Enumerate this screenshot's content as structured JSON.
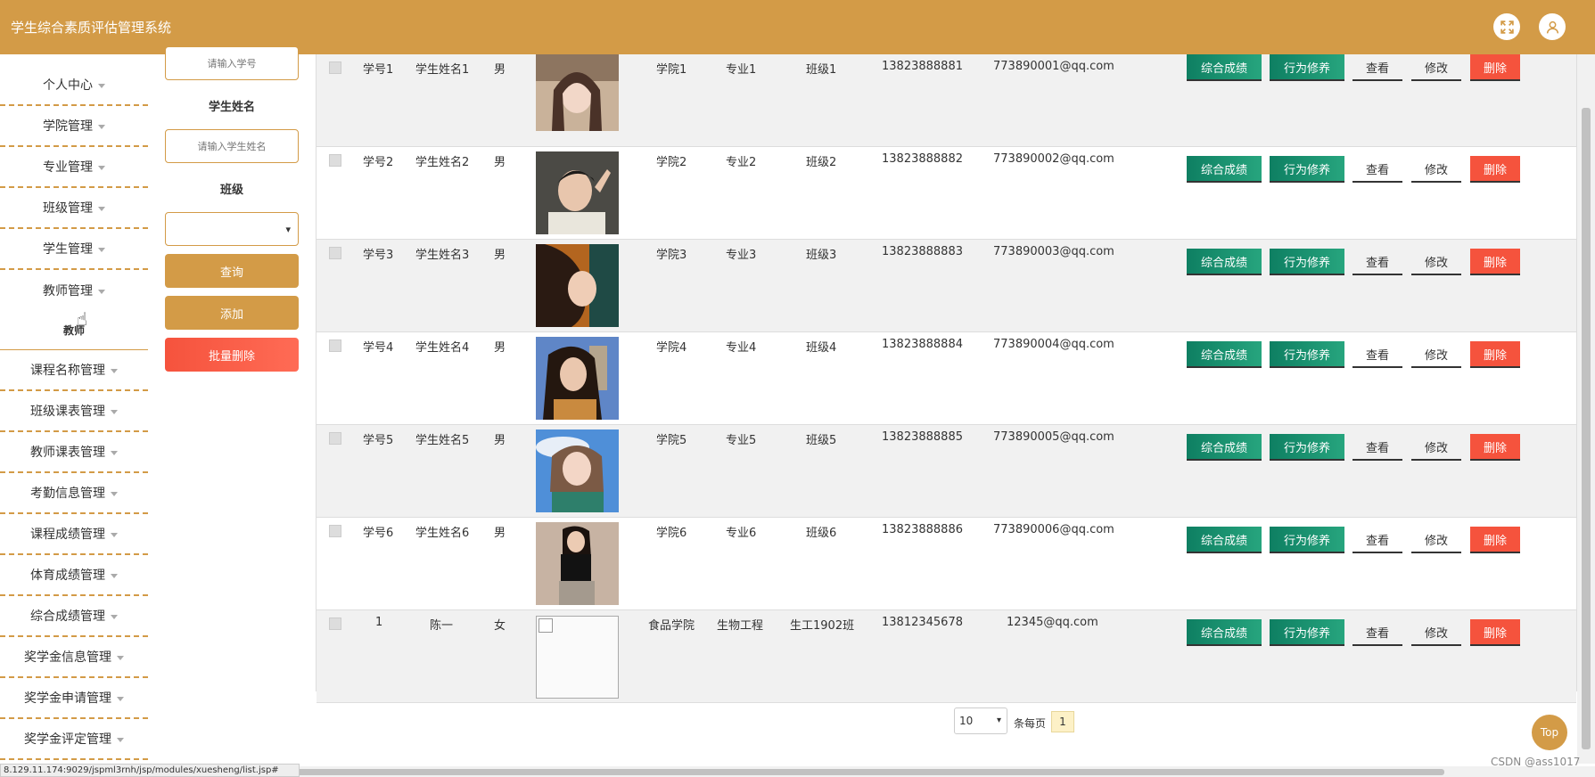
{
  "header": {
    "title": "学生综合素质评估管理系统",
    "fullscreen_icon": "expand-icon",
    "user_icon": "user-icon",
    "accent": "#d39b47"
  },
  "sidebar": {
    "items": [
      {
        "label": "个人中心"
      },
      {
        "label": "学院管理"
      },
      {
        "label": "专业管理"
      },
      {
        "label": "班级管理"
      },
      {
        "label": "学生管理"
      },
      {
        "label": "教师管理"
      }
    ],
    "sub": "教师",
    "items2": [
      {
        "label": "课程名称管理"
      },
      {
        "label": "班级课表管理"
      },
      {
        "label": "教师课表管理"
      },
      {
        "label": "考勤信息管理"
      },
      {
        "label": "课程成绩管理"
      },
      {
        "label": "体育成绩管理"
      },
      {
        "label": "综合成绩管理"
      },
      {
        "label": "奖学金信息管理"
      },
      {
        "label": "奖学金申请管理"
      },
      {
        "label": "奖学金评定管理"
      }
    ]
  },
  "filters": {
    "id_placeholder": "请输入学号",
    "name_label": "学生姓名",
    "name_placeholder": "请输入学生姓名",
    "class_label": "班级",
    "class_value": "",
    "query_button": "查询",
    "add_button": "添加",
    "batch_delete_button": "批量删除"
  },
  "table": {
    "actions": {
      "composite": "综合成绩",
      "behavior": "行为修养",
      "view": "查看",
      "edit": "修改",
      "delete": "删除"
    },
    "rows": [
      {
        "id": "学号1",
        "name": "学生姓名1",
        "gender": "男",
        "college": "学院1",
        "major": "专业1",
        "class": "班级1",
        "phone": "13823888881",
        "email": "773890001@qq.com"
      },
      {
        "id": "学号2",
        "name": "学生姓名2",
        "gender": "男",
        "college": "学院2",
        "major": "专业2",
        "class": "班级2",
        "phone": "13823888882",
        "email": "773890002@qq.com"
      },
      {
        "id": "学号3",
        "name": "学生姓名3",
        "gender": "男",
        "college": "学院3",
        "major": "专业3",
        "class": "班级3",
        "phone": "13823888883",
        "email": "773890003@qq.com"
      },
      {
        "id": "学号4",
        "name": "学生姓名4",
        "gender": "男",
        "college": "学院4",
        "major": "专业4",
        "class": "班级4",
        "phone": "13823888884",
        "email": "773890004@qq.com"
      },
      {
        "id": "学号5",
        "name": "学生姓名5",
        "gender": "男",
        "college": "学院5",
        "major": "专业5",
        "class": "班级5",
        "phone": "13823888885",
        "email": "773890005@qq.com"
      },
      {
        "id": "学号6",
        "name": "学生姓名6",
        "gender": "男",
        "college": "学院6",
        "major": "专业6",
        "class": "班级6",
        "phone": "13823888886",
        "email": "773890006@qq.com"
      },
      {
        "id": "1",
        "name": "陈一",
        "gender": "女",
        "college": "食品学院",
        "major": "生物工程",
        "class": "生工1902班",
        "phone": "13812345678",
        "email": "12345@qq.com"
      }
    ]
  },
  "pagination": {
    "page_size": "10",
    "per_page_label": "条每页",
    "current_page": "1"
  },
  "top_button": "Top",
  "status_url": "8.129.11.174:9029/jspml3rnh/jsp/modules/xuesheng/list.jsp#",
  "watermark": "CSDN @ass1017"
}
